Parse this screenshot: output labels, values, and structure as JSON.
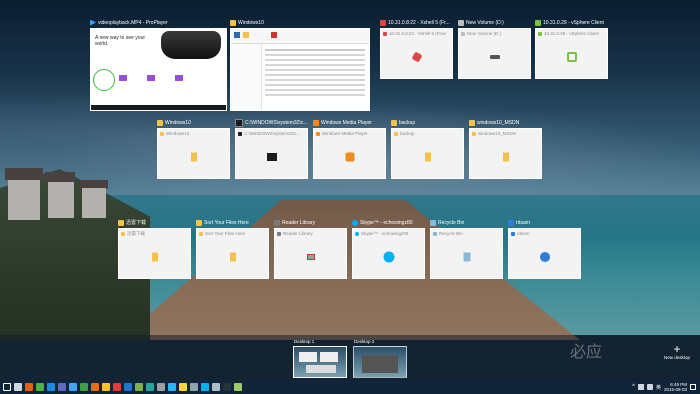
{
  "windows": [
    {
      "title": "videoplayback.MP4 - ProPlayer",
      "icon": "play-icon",
      "icon_color": "#3aa0ff",
      "label": "",
      "kind": "video"
    },
    {
      "title": "Windows10",
      "icon": "folder-icon",
      "icon_color": "#f4c24b",
      "label": "",
      "kind": "explorer"
    },
    {
      "title": "10.31.0.8:22 - Xshell 5 (Fr...",
      "icon": "xshell-icon",
      "icon_color": "#e0454c",
      "label": "10.31.0.8:22 - Xshell 5 (Free",
      "kind": "app"
    },
    {
      "title": "New Volume (D:)",
      "icon": "drive-icon",
      "icon_color": "#bdbdbd",
      "label": "New Volume (D:)",
      "kind": "app"
    },
    {
      "title": "10.31.0.29 - vSphere Client",
      "icon": "vsphere-icon",
      "icon_color": "#7cc142",
      "label": "10.31.0.29 - vSphere Client",
      "kind": "app"
    },
    {
      "title": "Windows10",
      "icon": "folder-icon",
      "icon_color": "#f4c24b",
      "label": "Windows10",
      "kind": "app"
    },
    {
      "title": "C:\\WINDOWS\\system32\\c...",
      "icon": "cmd-icon",
      "icon_color": "#1c1c1c",
      "label": "C:\\WINDOWS\\system32\\c...",
      "kind": "app"
    },
    {
      "title": "Windows Media Player",
      "icon": "media-player-icon",
      "icon_color": "#f08a1d",
      "label": "Windows Media Player",
      "kind": "app"
    },
    {
      "title": "backup",
      "icon": "folder-icon",
      "icon_color": "#f4c24b",
      "label": "backup",
      "kind": "app"
    },
    {
      "title": "windows10_MSDN",
      "icon": "folder-icon",
      "icon_color": "#f4c24b",
      "label": "windows10_MSDN",
      "kind": "app"
    },
    {
      "title": "迅雷下载",
      "icon": "folder-icon",
      "icon_color": "#f4c24b",
      "label": "迅雷下载",
      "kind": "app"
    },
    {
      "title": "Sort Your Files Here",
      "icon": "folder-icon",
      "icon_color": "#f4c24b",
      "label": "Sort Your Files Here",
      "kind": "app"
    },
    {
      "title": "Reader Library",
      "icon": "reader-icon",
      "icon_color": "#7b7b7b",
      "label": "Reader Library",
      "kind": "app"
    },
    {
      "title": "Skype™ - echowingz80",
      "icon": "skype-icon",
      "icon_color": "#00aff0",
      "label": "Skype™ - echowingz80",
      "kind": "app"
    },
    {
      "title": "Recycle Bin",
      "icon": "recycle-bin-icon",
      "icon_color": "#8ab8d8",
      "label": "Recycle Bin",
      "kind": "app"
    },
    {
      "title": "rdsam",
      "icon": "remote-desktop-icon",
      "icon_color": "#2b7fd6",
      "label": "rdsam",
      "kind": "app"
    }
  ],
  "desktops": [
    {
      "label": "Desktop 1"
    },
    {
      "label": "Desktop 2"
    }
  ],
  "new_desktop": {
    "plus": "+",
    "label": "New desktop"
  },
  "watermark": "必应",
  "video": {
    "headline": "A new way to see your world.",
    "cols": [
      "",
      "",
      "",
      ""
    ]
  },
  "tray": {
    "time": "6:49 PM",
    "date": "2015-08-03",
    "lang": "英"
  },
  "taskbar": [
    {
      "icon": "start-icon",
      "color": "#ffffff"
    },
    {
      "icon": "task-view-icon",
      "color": "#cfd8e0"
    },
    {
      "icon": "firefox-icon",
      "color": "#e66000"
    },
    {
      "icon": "chrome-icon",
      "color": "#4caf50"
    },
    {
      "icon": "outlook-icon",
      "color": "#1e88e5"
    },
    {
      "icon": "network-icon",
      "color": "#5c6bc0"
    },
    {
      "icon": "photos-icon",
      "color": "#42a5f5"
    },
    {
      "icon": "green-app-icon",
      "color": "#43a047"
    },
    {
      "icon": "media-icon",
      "color": "#ef6c00"
    },
    {
      "icon": "folder-app-icon",
      "color": "#fbc02d"
    },
    {
      "icon": "xshell-app-icon",
      "color": "#e53935"
    },
    {
      "icon": "blue-app-icon",
      "color": "#1976d2"
    },
    {
      "icon": "vsphere-app-icon",
      "color": "#7cb342"
    },
    {
      "icon": "store-icon",
      "color": "#26a69a"
    },
    {
      "icon": "alien-icon",
      "color": "#9e9e9e"
    },
    {
      "icon": "chat-icon",
      "color": "#29b6f6"
    },
    {
      "icon": "explorer-icon",
      "color": "#fdd835"
    },
    {
      "icon": "settings-icon",
      "color": "#90a4ae"
    },
    {
      "icon": "skype-app-icon",
      "color": "#00aff0"
    },
    {
      "icon": "recycle-app-icon",
      "color": "#b0bec5"
    },
    {
      "icon": "console-icon",
      "color": "#263238"
    },
    {
      "icon": "library-icon",
      "color": "#9ccc65"
    }
  ]
}
